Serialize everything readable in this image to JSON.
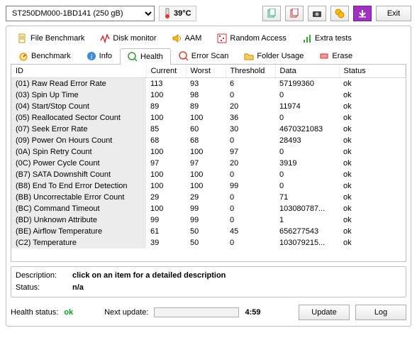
{
  "top": {
    "drive": "ST250DM000-1BD141 (250 gB)",
    "temp": "39°C",
    "exit": "Exit"
  },
  "tabs_upper": {
    "file_benchmark": "File Benchmark",
    "disk_monitor": "Disk monitor",
    "aam": "AAM",
    "random_access": "Random Access",
    "extra_tests": "Extra tests"
  },
  "tabs_lower": {
    "benchmark": "Benchmark",
    "info": "Info",
    "health": "Health",
    "error_scan": "Error Scan",
    "folder_usage": "Folder Usage",
    "erase": "Erase"
  },
  "columns": [
    "ID",
    "Current",
    "Worst",
    "Threshold",
    "Data",
    "Status"
  ],
  "rows": [
    {
      "id": "(01) Raw Read Error Rate",
      "cur": "113",
      "wor": "93",
      "thr": "6",
      "dat": "57199360",
      "sta": "ok"
    },
    {
      "id": "(03) Spin Up Time",
      "cur": "100",
      "wor": "98",
      "thr": "0",
      "dat": "0",
      "sta": "ok"
    },
    {
      "id": "(04) Start/Stop Count",
      "cur": "89",
      "wor": "89",
      "thr": "20",
      "dat": "11974",
      "sta": "ok"
    },
    {
      "id": "(05) Reallocated Sector Count",
      "cur": "100",
      "wor": "100",
      "thr": "36",
      "dat": "0",
      "sta": "ok"
    },
    {
      "id": "(07) Seek Error Rate",
      "cur": "85",
      "wor": "60",
      "thr": "30",
      "dat": "4670321083",
      "sta": "ok"
    },
    {
      "id": "(09) Power On Hours Count",
      "cur": "68",
      "wor": "68",
      "thr": "0",
      "dat": "28493",
      "sta": "ok"
    },
    {
      "id": "(0A) Spin Retry Count",
      "cur": "100",
      "wor": "100",
      "thr": "97",
      "dat": "0",
      "sta": "ok"
    },
    {
      "id": "(0C) Power Cycle Count",
      "cur": "97",
      "wor": "97",
      "thr": "20",
      "dat": "3919",
      "sta": "ok"
    },
    {
      "id": "(B7) SATA Downshift Count",
      "cur": "100",
      "wor": "100",
      "thr": "0",
      "dat": "0",
      "sta": "ok"
    },
    {
      "id": "(B8) End To End Error Detection",
      "cur": "100",
      "wor": "100",
      "thr": "99",
      "dat": "0",
      "sta": "ok"
    },
    {
      "id": "(BB) Uncorrectable Error Count",
      "cur": "29",
      "wor": "29",
      "thr": "0",
      "dat": "71",
      "sta": "ok"
    },
    {
      "id": "(BC) Command Timeout",
      "cur": "100",
      "wor": "99",
      "thr": "0",
      "dat": "103080787...",
      "sta": "ok"
    },
    {
      "id": "(BD) Unknown Attribute",
      "cur": "99",
      "wor": "99",
      "thr": "0",
      "dat": "1",
      "sta": "ok"
    },
    {
      "id": "(BE) Airflow Temperature",
      "cur": "61",
      "wor": "50",
      "thr": "45",
      "dat": "656277543",
      "sta": "ok"
    },
    {
      "id": "(C2) Temperature",
      "cur": "39",
      "wor": "50",
      "thr": "0",
      "dat": "103079215...",
      "sta": "ok"
    }
  ],
  "description": {
    "desc_label": "Description:",
    "desc_value": "click on an item for a detailed description",
    "status_label": "Status:",
    "status_value": "n/a"
  },
  "footer": {
    "health_label": "Health status:",
    "health_value": "ok",
    "next_update_label": "Next update:",
    "countdown": "4:59",
    "update_btn": "Update",
    "log_btn": "Log"
  }
}
